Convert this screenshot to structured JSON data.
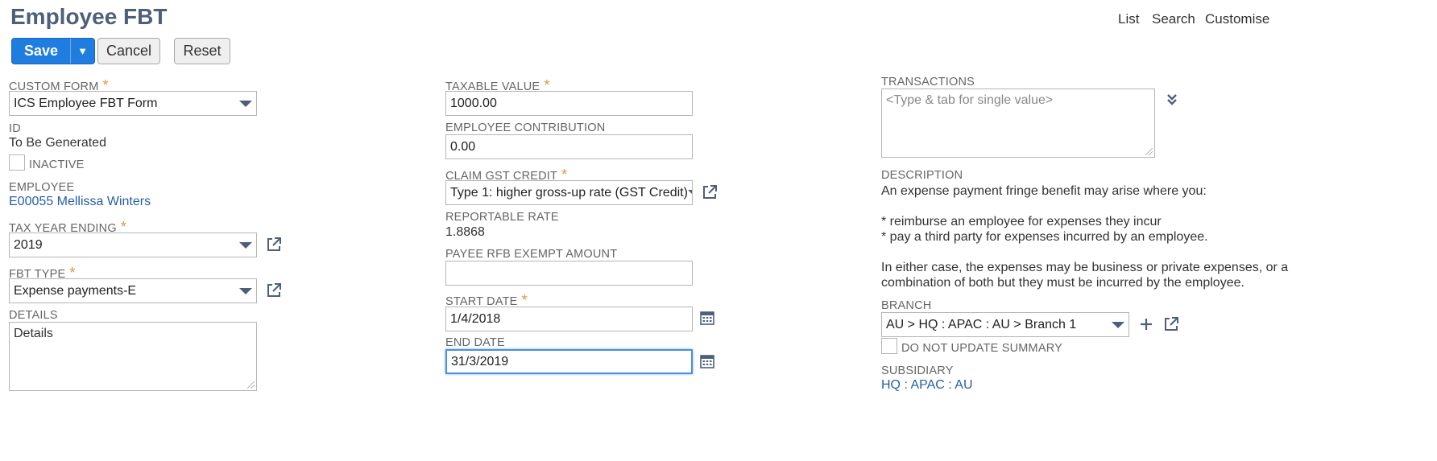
{
  "header": {
    "title": "Employee FBT",
    "nav": [
      "List",
      "Search",
      "Customise"
    ]
  },
  "toolbar": {
    "save_label": "Save",
    "save_menu_glyph": "▼",
    "cancel_label": "Cancel",
    "reset_label": "Reset"
  },
  "form": {
    "custom_form": {
      "label": "CUSTOM FORM",
      "required": "*",
      "value": "ICS Employee FBT Form"
    },
    "id": {
      "label": "ID",
      "value": "To Be Generated"
    },
    "inactive": {
      "label": "INACTIVE",
      "checked": false
    },
    "employee": {
      "label": "EMPLOYEE",
      "value": "E00055 Mellissa Winters"
    },
    "tax_year_ending": {
      "label": "TAX YEAR ENDING",
      "required": "*",
      "value": "2019"
    },
    "fbt_type": {
      "label": "FBT TYPE",
      "required": "*",
      "value": "Expense payments-E"
    },
    "details": {
      "label": "DETAILS",
      "value": "Details"
    },
    "taxable_value": {
      "label": "TAXABLE VALUE",
      "required": "*",
      "value": "1000.00"
    },
    "employee_contribution": {
      "label": "EMPLOYEE CONTRIBUTION",
      "value": "0.00"
    },
    "claim_gst_credit": {
      "label": "CLAIM GST CREDIT",
      "required": "*",
      "value": "Type 1: higher gross-up rate (GST Credit)"
    },
    "reportable_rate": {
      "label": "REPORTABLE RATE",
      "value": "1.8868"
    },
    "payee_rfb_exempt_amount": {
      "label": "PAYEE RFB EXEMPT AMOUNT",
      "value": ""
    },
    "start_date": {
      "label": "START DATE",
      "required": "*",
      "value": "1/4/2018"
    },
    "end_date": {
      "label": "END DATE",
      "value": "31/3/2019"
    },
    "transactions": {
      "label": "TRANSACTIONS",
      "placeholder": "<Type & tab for single value>"
    },
    "description": {
      "label": "DESCRIPTION",
      "lines": [
        "An expense payment fringe benefit may arise where you:",
        "",
        "* reimburse an employee for expenses they incur",
        "* pay a third party for expenses incurred by an employee.",
        "",
        "In either case, the expenses may be business or private expenses, or a",
        "combination of both but they must be incurred by the employee."
      ]
    },
    "branch": {
      "label": "BRANCH",
      "value": "AU > HQ : APAC : AU > Branch 1"
    },
    "do_not_update_summary": {
      "label": "DO NOT UPDATE SUMMARY",
      "checked": false
    },
    "subsidiary": {
      "label": "SUBSIDIARY",
      "value": "HQ : APAC : AU"
    }
  },
  "colors": {
    "title": "#4d5f79",
    "primary_button": "#1f7de0",
    "link": "#255ea7",
    "required": "#e8923c",
    "focus_border": "#4a90e2"
  },
  "icons": [
    "chevron-down-icon",
    "open-external-icon",
    "calendar-icon",
    "plus-icon",
    "double-chevron-down-icon"
  ]
}
